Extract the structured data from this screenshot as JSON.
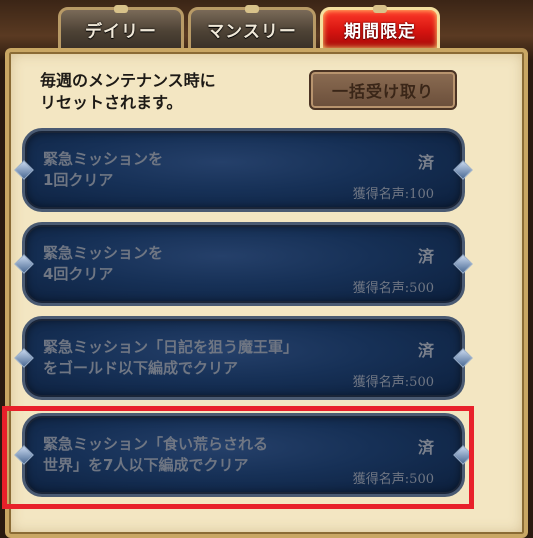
{
  "tabs": [
    {
      "label": "デイリー",
      "active": false
    },
    {
      "label": "マンスリー",
      "active": false
    },
    {
      "label": "期間限定",
      "active": true
    }
  ],
  "notice": "毎週のメンテナンス時に\nリセットされます。",
  "claim_all_label": "一括受け取り",
  "missions": [
    {
      "title": "緊急ミッションを\n1回クリア",
      "status": "済",
      "reward": "獲得名声:100"
    },
    {
      "title": "緊急ミッションを\n4回クリア",
      "status": "済",
      "reward": "獲得名声:500"
    },
    {
      "title": "緊急ミッション「日記を狙う魔王軍」\nをゴールド以下編成でクリア",
      "status": "済",
      "reward": "獲得名声:500"
    },
    {
      "title": "緊急ミッション「食い荒らされる\n世界」を7人以下編成でクリア",
      "status": "済",
      "reward": "獲得名声:500"
    }
  ],
  "colors": {
    "active_tab": "#d61410",
    "highlight_box": "#e8202a",
    "mission_bg": "#163056"
  }
}
